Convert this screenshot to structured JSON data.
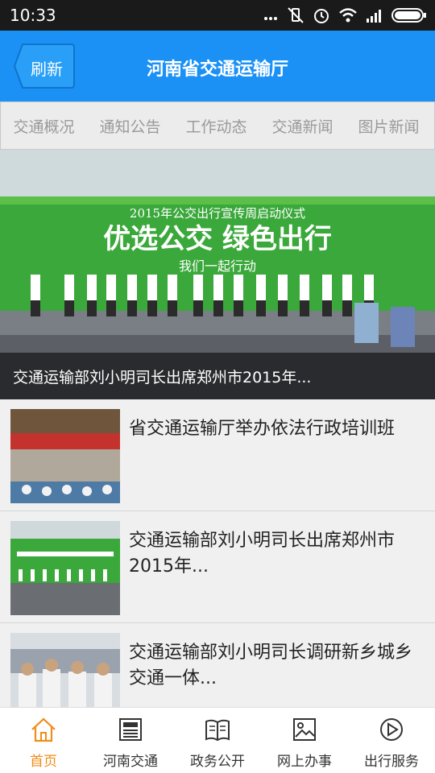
{
  "status": {
    "time": "10:33"
  },
  "header": {
    "refresh_label": "刷新",
    "title": "河南省交通运输厅"
  },
  "tabs": [
    {
      "label": "交通概况"
    },
    {
      "label": "通知公告"
    },
    {
      "label": "工作动态"
    },
    {
      "label": "交通新闻"
    },
    {
      "label": "图片新闻"
    }
  ],
  "hero": {
    "banner_line1": "2015年公交出行宣传周启动仪式",
    "banner_line2": "优选公交   绿色出行",
    "banner_line3": "我们一起行动",
    "caption": "交通运输部刘小明司长出席郑州市2015年..."
  },
  "news": [
    {
      "title": "省交通运输厅举办依法行政培训班"
    },
    {
      "title": "交通运输部刘小明司长出席郑州市2015年..."
    },
    {
      "title": "交通运输部刘小明司长调研新乡城乡交通一体..."
    }
  ],
  "bottom_nav": [
    {
      "label": "首页",
      "icon": "home-icon"
    },
    {
      "label": "河南交通",
      "icon": "newspaper-icon"
    },
    {
      "label": "政务公开",
      "icon": "book-icon"
    },
    {
      "label": "网上办事",
      "icon": "image-icon"
    },
    {
      "label": "出行服务",
      "icon": "play-icon"
    }
  ],
  "colors": {
    "appbar": "#1b90f5",
    "active": "#f08c18"
  }
}
